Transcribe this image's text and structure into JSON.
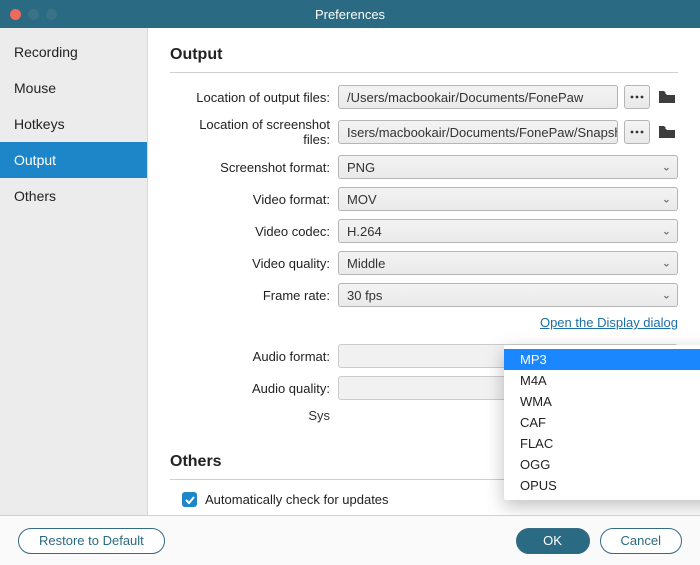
{
  "window": {
    "title": "Preferences"
  },
  "sidebar": {
    "items": [
      {
        "label": "Recording"
      },
      {
        "label": "Mouse"
      },
      {
        "label": "Hotkeys"
      },
      {
        "label": "Output"
      },
      {
        "label": "Others"
      }
    ],
    "selected_index": 3
  },
  "sections": {
    "output_title": "Output",
    "others_title": "Others"
  },
  "output": {
    "labels": {
      "output_location": "Location of output files:",
      "screenshot_location": "Location of screenshot files:",
      "screenshot_format": "Screenshot format:",
      "video_format": "Video format:",
      "video_codec": "Video codec:",
      "video_quality": "Video quality:",
      "frame_rate": "Frame rate:",
      "audio_format": "Audio format:",
      "audio_quality": "Audio quality:",
      "sys": "Sys"
    },
    "values": {
      "output_location": "/Users/macbookair/Documents/FonePaw",
      "screenshot_location": "Isers/macbookair/Documents/FonePaw/Snapshot",
      "screenshot_format": "PNG",
      "video_format": "MOV",
      "video_codec": "H.264",
      "video_quality": "Middle",
      "frame_rate": "30 fps"
    },
    "display_link": "Open the Display dialog",
    "trailing_link_fragment": "og",
    "audio_format_options": [
      "MP3",
      "M4A",
      "WMA",
      "CAF",
      "FLAC",
      "OGG",
      "OPUS"
    ],
    "audio_format_selected": "MP3"
  },
  "others": {
    "auto_update_label": "Automatically check for updates",
    "auto_update_checked": true
  },
  "footer": {
    "restore": "Restore to Default",
    "ok": "OK",
    "cancel": "Cancel"
  }
}
